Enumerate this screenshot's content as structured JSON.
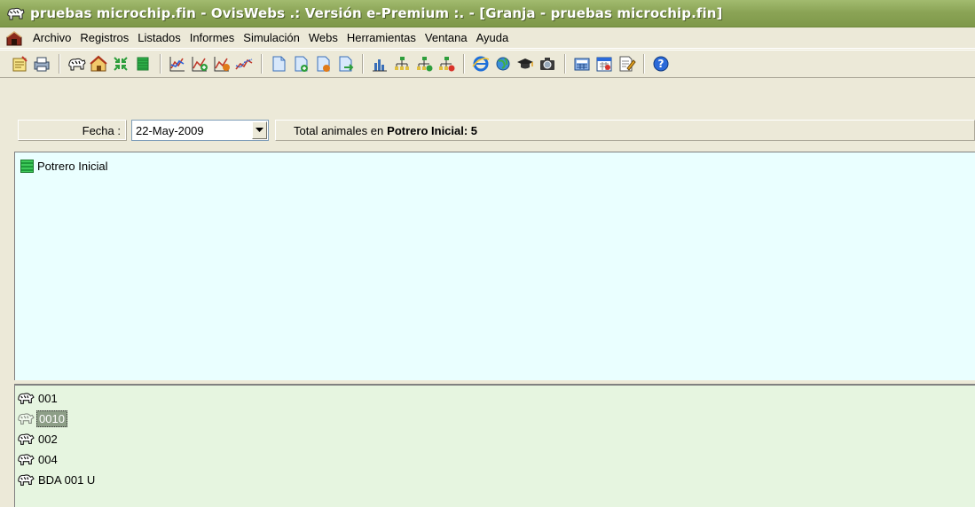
{
  "window": {
    "title": "pruebas microchip.fin - OvisWebs  .: Versión e-Premium :. - [Granja - pruebas microchip.fin]"
  },
  "menu": {
    "items": [
      "Archivo",
      "Registros",
      "Listados",
      "Informes",
      "Simulación",
      "Webs",
      "Herramientas",
      "Ventana",
      "Ayuda"
    ]
  },
  "toolbar": {
    "groups": [
      [
        "notes-icon",
        "printer-icon"
      ],
      [
        "sheep-icon",
        "house-icon",
        "shrink-icon",
        "green-field-icon"
      ],
      [
        "chart-icon",
        "chart-plus-icon",
        "chart-edit-icon",
        "line-chart-icon"
      ],
      [
        "doc-icon",
        "doc-plus-icon",
        "doc-edit-icon",
        "doc-export-icon"
      ],
      [
        "bar-chart-icon",
        "tree-icon",
        "tree-plus-icon",
        "tree-edit-icon"
      ],
      [
        "ie-icon",
        "globe-icon",
        "graduation-icon",
        "camera-icon"
      ],
      [
        "calculator-icon",
        "calendar-icon",
        "edit-icon"
      ],
      [
        "help-icon"
      ]
    ]
  },
  "filters": {
    "fecha_label": "Fecha :",
    "date_value": "22-May-2009",
    "total_prefix": "Total animales en",
    "total_value": "Potrero Inicial: 5"
  },
  "potreros": {
    "items": [
      {
        "label": "Potrero Inicial"
      }
    ]
  },
  "animals": {
    "items": [
      {
        "label": "001",
        "selected": false
      },
      {
        "label": "0010",
        "selected": true
      },
      {
        "label": "002",
        "selected": false
      },
      {
        "label": "004",
        "selected": false
      },
      {
        "label": "BDA 001 U",
        "selected": false
      }
    ]
  },
  "colors": {
    "titlebar": "#8ba456",
    "potrero_bg": "#eaffff",
    "animal_bg": "#e6f5e0",
    "field_green": "#2fb24a"
  }
}
